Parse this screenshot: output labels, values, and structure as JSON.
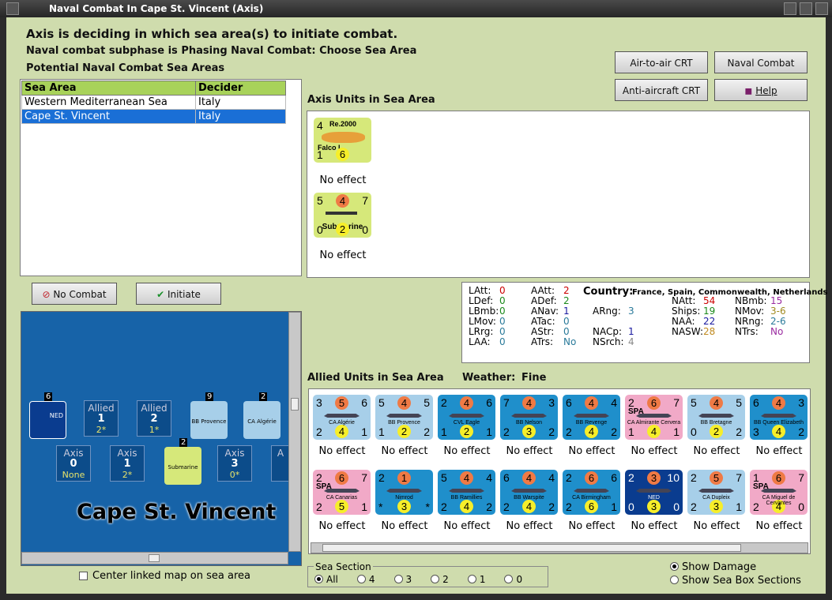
{
  "window": {
    "title": "Naval Combat In Cape St. Vincent (Axis)"
  },
  "header": {
    "line1": "Axis is deciding in which sea area(s) to initiate combat.",
    "line2": "Naval combat subphase is Phasing Naval Combat: Choose Sea Area",
    "line3": "Potential Naval Combat Sea Areas"
  },
  "buttons": {
    "air_to_air": "Air-to-air CRT",
    "naval_chart": "Naval Combat Chart",
    "anti_aircraft": "Anti-aircraft CRT",
    "help": "Help",
    "no_combat": "No Combat",
    "initiate_combat": "Initiate Combat"
  },
  "sea_table": {
    "columns": [
      "Sea Area",
      "Decider"
    ],
    "rows": [
      {
        "area": "Western Mediterranean Sea",
        "decider": "Italy"
      },
      {
        "area": "Cape St. Vincent",
        "decider": "Italy"
      }
    ]
  },
  "axis_panel": {
    "title": "Axis Units in Sea Area",
    "units": [
      {
        "name": "Re.2000",
        "sub": "Falco I",
        "tl": "4",
        "bl": "1",
        "mid": "6",
        "result": "No effect"
      },
      {
        "name": "Submarine",
        "tl": "5",
        "tr": "7",
        "top": "4",
        "bl": "0",
        "br": "0",
        "mid": "2",
        "result": "No effect"
      }
    ]
  },
  "stats": {
    "country_label": "Country:",
    "country": "France, Spain, Commonwealth, Netherlands",
    "left": [
      [
        "LAtt:",
        "0"
      ],
      [
        "LDef:",
        "0"
      ],
      [
        "LBmb:",
        "0"
      ],
      [
        "LMov:",
        "0"
      ],
      [
        "LRrg:",
        "0"
      ],
      [
        "LAA:",
        "0"
      ]
    ],
    "mid": [
      [
        "AAtt:",
        "2"
      ],
      [
        "ADef:",
        "2"
      ],
      [
        "ANav:",
        "1"
      ],
      [
        "ATac:",
        "0"
      ],
      [
        "AStr:",
        "0"
      ],
      [
        "ATrs:",
        "No"
      ]
    ],
    "mid2": [
      [
        "ARng:",
        "3"
      ],
      [
        "NACp:",
        "1"
      ],
      [
        "NSrch:",
        "4"
      ]
    ],
    "right": [
      [
        "NAtt:",
        "54"
      ],
      [
        "Ships:",
        "19"
      ],
      [
        "NAA:",
        "22"
      ],
      [
        "NASW:",
        "28"
      ]
    ],
    "right2": [
      [
        "NBmb:",
        "15"
      ],
      [
        "NMov:",
        "3-6"
      ],
      [
        "NRng:",
        "2-6"
      ],
      [
        "NTrs:",
        "No"
      ]
    ]
  },
  "allied_panel": {
    "title": "Allied Units in Sea Area",
    "weather_label": "Weather:",
    "weather": "Fine"
  },
  "allied_units": [
    {
      "name": "CA Algérie",
      "tl": "3",
      "top": "5",
      "tr": "6",
      "bl": "2",
      "mid": "4",
      "br": "1",
      "color": "c-lb",
      "result": "No effect"
    },
    {
      "name": "BB Provence",
      "tl": "5",
      "top": "4",
      "tr": "5",
      "bl": "1",
      "mid": "2",
      "br": "2",
      "color": "c-lb",
      "result": "No effect"
    },
    {
      "name": "CVL Eagle",
      "tl": "2",
      "top": "4",
      "tr": "6",
      "bl": "1",
      "mid": "2",
      "br": "1",
      "color": "c-db",
      "result": "No effect"
    },
    {
      "name": "BB Nelson",
      "tl": "7",
      "top": "4",
      "tr": "3",
      "bl": "2",
      "mid": "3",
      "br": "2",
      "color": "c-db",
      "result": "No effect"
    },
    {
      "name": "BB Revenge",
      "tl": "6",
      "top": "4",
      "tr": "4",
      "bl": "2",
      "mid": "4",
      "br": "2",
      "color": "c-db",
      "result": "No effect"
    },
    {
      "name": "CA Almirante Cervera",
      "tl": "2",
      "top": "6",
      "tr": "7",
      "bl": "1",
      "mid": "4",
      "br": "1",
      "color": "c-pk",
      "flag": "SPA",
      "result": "No effect"
    },
    {
      "name": "BB Bretagne",
      "tl": "5",
      "top": "4",
      "tr": "5",
      "bl": "0",
      "mid": "2",
      "br": "2",
      "color": "c-lb",
      "result": "No effect"
    },
    {
      "name": "BB Queen Elizabeth",
      "tl": "6",
      "top": "4",
      "tr": "3",
      "bl": "3",
      "mid": "4",
      "br": "2",
      "color": "c-db",
      "result": "No effect"
    },
    {
      "name": "CA Canarias",
      "tl": "2",
      "top": "6",
      "tr": "7",
      "bl": "2",
      "mid": "5",
      "br": "1",
      "color": "c-pk",
      "flag": "SPA",
      "result": "No effect"
    },
    {
      "name": "Nimrod",
      "tl": "2",
      "top": "1",
      "tr": "",
      "bl": "*",
      "mid": "3",
      "br": "*",
      "color": "c-db",
      "result": "No effect"
    },
    {
      "name": "BB Ramillies",
      "tl": "5",
      "top": "4",
      "tr": "4",
      "bl": "2",
      "mid": "4",
      "br": "2",
      "color": "c-db",
      "result": "No effect"
    },
    {
      "name": "BB Warspite",
      "tl": "6",
      "top": "4",
      "tr": "4",
      "bl": "2",
      "mid": "4",
      "br": "2",
      "color": "c-db",
      "result": "No effect"
    },
    {
      "name": "CA Birmingham",
      "tl": "2",
      "top": "6",
      "tr": "6",
      "bl": "2",
      "mid": "6",
      "br": "1",
      "color": "c-db",
      "result": "No effect"
    },
    {
      "name": "NED",
      "tl": "2",
      "top": "3",
      "tr": "10",
      "bl": "0",
      "mid": "3",
      "br": "0",
      "color": "c-nv",
      "result": "No effect"
    },
    {
      "name": "CA Dupleix",
      "tl": "2",
      "top": "5",
      "tr": "7",
      "bl": "2",
      "mid": "3",
      "br": "1",
      "color": "c-lb",
      "result": "No effect"
    },
    {
      "name": "CA Miguel de Cervantes",
      "tl": "1",
      "top": "6",
      "tr": "7",
      "bl": "2",
      "mid": "4",
      "br": "0",
      "color": "c-pk",
      "flag": "SPA",
      "result": "No effect"
    }
  ],
  "map": {
    "sea_name": "Cape St. Vincent",
    "boxes_top": [
      {
        "side": "Allied",
        "num": "1",
        "val": "2*"
      },
      {
        "side": "Allied",
        "num": "2",
        "val": "1*"
      }
    ],
    "boxes_bottom": [
      {
        "side": "Axis",
        "num": "0",
        "val": "None"
      },
      {
        "side": "Axis",
        "num": "1",
        "val": "2*"
      },
      {
        "side": "Axis",
        "num": "3",
        "val": "0*"
      },
      {
        "side": "A",
        "num": "",
        "val": ""
      }
    ],
    "stack_counts": [
      "6",
      "9",
      "2",
      "2"
    ],
    "unit_labels": [
      "BB Provence",
      "CA Algérie",
      "Submarine",
      "NED"
    ],
    "center_label": "Center linked map on sea area"
  },
  "sea_section": {
    "label": "Sea Section",
    "options": [
      "All",
      "4",
      "3",
      "2",
      "1",
      "0"
    ],
    "selected": "All"
  },
  "display": {
    "show_damage": "Show Damage",
    "show_sections": "Show Sea Box Sections"
  }
}
